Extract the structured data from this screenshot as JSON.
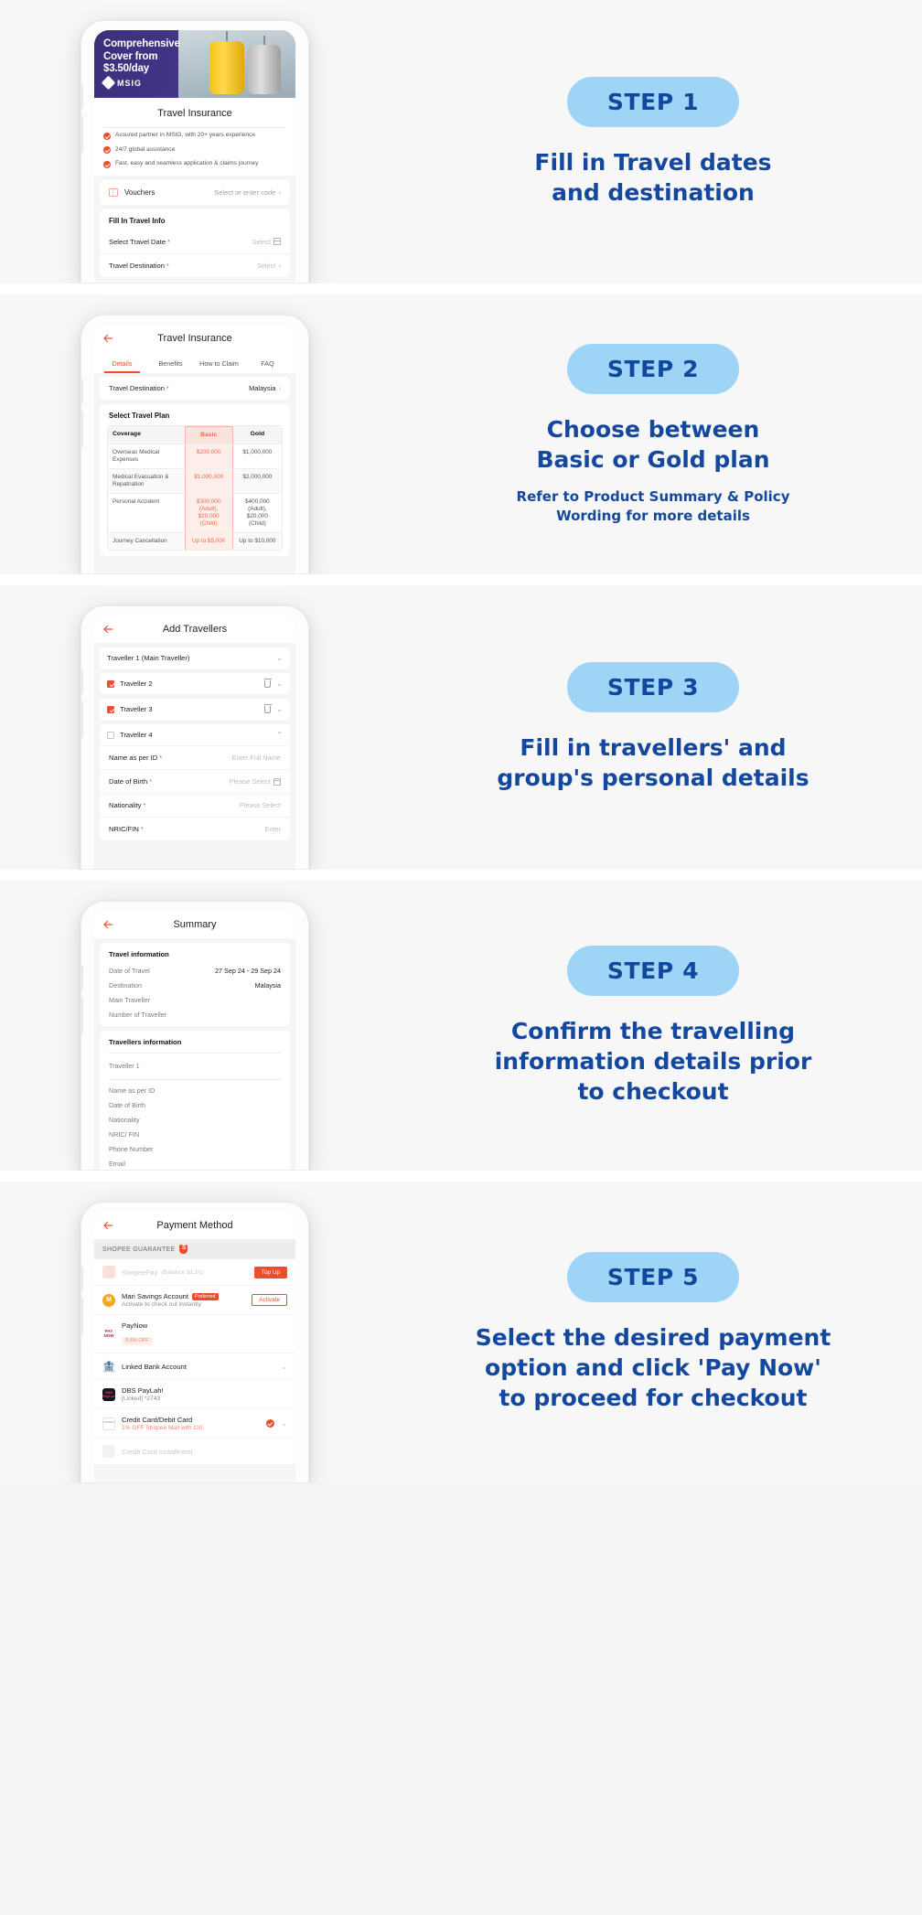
{
  "steps": [
    {
      "badge": "STEP 1",
      "desc": "Fill in Travel dates\nand destination",
      "sub": "",
      "phone": {
        "banner": {
          "line1": "Comprehensive",
          "line2": "Cover from",
          "line3": "$3.50/day",
          "brand": "MSIG"
        },
        "title": "Travel Insurance",
        "features": [
          "Assured partner in MSIG, with 20+ years experience",
          "24/7 global assistance",
          "Fast, easy and seamless application & claims journey"
        ],
        "voucher_label": "Vouchers",
        "voucher_value": "Select or enter code",
        "section": "Fill In Travel Info",
        "fields": [
          {
            "label": "Select Travel Date",
            "required": true,
            "value": "Select"
          },
          {
            "label": "Travel Destination",
            "required": true,
            "value": "Select"
          }
        ]
      }
    },
    {
      "badge": "STEP 2",
      "desc": "Choose between\nBasic or Gold plan",
      "sub": "Refer to Product Summary & Policy\nWording for more details",
      "phone": {
        "title": "Travel Insurance",
        "tabs": [
          "Details",
          "Benefits",
          "How to Claim",
          "FAQ"
        ],
        "active_tab": "Details",
        "destination_label": "Travel Destination",
        "destination_value": "Malaysia",
        "plan_heading": "Select Travel Plan",
        "table": {
          "headers": [
            "Coverage",
            "Basic",
            "Gold"
          ],
          "rows": [
            {
              "coverage": "Overseas Medical Expenses",
              "basic": "$200,000",
              "gold": "$1,000,000"
            },
            {
              "coverage": "Medical Evacuation & Repatriation",
              "basic": "$1,000,000",
              "gold": "$2,000,000"
            },
            {
              "coverage": "Personal Accident",
              "basic": "$300,000 (Adult), $20,000 (Child)",
              "gold": "$400,000 (Adult), $20,000 (Child)"
            },
            {
              "coverage": "Journey Cancellation",
              "basic": "Up to $5,000",
              "gold": "Up to $10,000"
            }
          ]
        }
      }
    },
    {
      "badge": "STEP 3",
      "desc": "Fill in travellers' and\ngroup's personal details",
      "sub": "",
      "phone": {
        "title": "Add Travellers",
        "travellers": [
          {
            "label": "Traveller 1 (Main Traveller)",
            "checkbox": false,
            "checked": false,
            "trash": false
          },
          {
            "label": "Traveller 2",
            "checkbox": true,
            "checked": true,
            "trash": true
          },
          {
            "label": "Traveller 3",
            "checkbox": true,
            "checked": true,
            "trash": true
          },
          {
            "label": "Traveller 4",
            "checkbox": true,
            "checked": false,
            "trash": false
          }
        ],
        "fields": [
          {
            "label": "Name as per ID",
            "required": true,
            "value": "Enter Full Name"
          },
          {
            "label": "Date of Birth",
            "required": true,
            "value": "Please Select"
          },
          {
            "label": "Nationality",
            "required": true,
            "value": "Please Select"
          },
          {
            "label": "NRIC/FIN",
            "required": true,
            "value": "Enter"
          }
        ]
      }
    },
    {
      "badge": "STEP 4",
      "desc": "Confirm the travelling\ninformation details prior\nto checkout",
      "sub": "",
      "phone": {
        "title": "Summary",
        "travel_heading": "Travel information",
        "travel_rows": [
          {
            "k": "Date of Travel",
            "v": "27 Sep 24 - 29 Sep 24"
          },
          {
            "k": "Destination",
            "v": "Malaysia"
          },
          {
            "k": "Main Traveller",
            "v": ""
          },
          {
            "k": "Number of Traveller",
            "v": ""
          }
        ],
        "travellers_heading": "Travellers information",
        "traveller_label": "Traveller 1",
        "traveller_rows": [
          {
            "k": "Name as per ID",
            "v": ""
          },
          {
            "k": "Date of Birth",
            "v": ""
          },
          {
            "k": "Nationality",
            "v": ""
          },
          {
            "k": "NRIC/ FIN",
            "v": ""
          },
          {
            "k": "Phone Number",
            "v": ""
          },
          {
            "k": "Email",
            "v": ""
          }
        ]
      }
    },
    {
      "badge": "STEP 5",
      "desc": "Select the desired payment\noption and click 'Pay Now'\nto proceed for checkout",
      "sub": "",
      "phone": {
        "title": "Payment Method",
        "guarantee": "SHOPEE GUARANTEE",
        "methods": [
          {
            "name": "ShopeePay",
            "note": "(Balance $1.91)",
            "sub": "",
            "badge": "",
            "action": "Top Up",
            "action_style": "fill",
            "dim": true,
            "selected": false,
            "icon_color": "#fbe0d8"
          },
          {
            "name": "Mari Savings Account",
            "note": "",
            "sub": "Activate to check out instantly",
            "badge": "Preferred",
            "action": "Activate",
            "action_style": "outline",
            "dim": false,
            "selected": false,
            "icon_color": "#f5a623"
          },
          {
            "name": "PayNow",
            "note": "",
            "sub": "",
            "badge": "",
            "offer": "0.5% OFF",
            "action": "",
            "action_style": "",
            "dim": false,
            "selected": false,
            "icon_color": "#ffffff"
          },
          {
            "name": "Linked Bank Account",
            "note": "",
            "sub": "",
            "badge": "",
            "action": "",
            "action_style": "",
            "dim": false,
            "selected": false,
            "icon_color": "#f3c33c",
            "chevron": true
          },
          {
            "name": "DBS PayLah!",
            "note": "",
            "sub": "[Linked] *2743",
            "badge": "",
            "action": "",
            "action_style": "",
            "dim": false,
            "selected": false,
            "icon_color": "#1b1b3a"
          },
          {
            "name": "Credit Card/Debit Card",
            "note": "",
            "sub": "1% OFF Shopee Mall with Citi",
            "badge": "",
            "action": "",
            "action_style": "",
            "dim": false,
            "selected": true,
            "icon_color": "#ffffff",
            "chevron": true
          },
          {
            "name": "Credit Card Installment",
            "note": "",
            "sub": "",
            "badge": "",
            "action": "",
            "action_style": "",
            "dim": true,
            "selected": false,
            "icon_color": "#f0f0f0"
          }
        ]
      }
    }
  ]
}
